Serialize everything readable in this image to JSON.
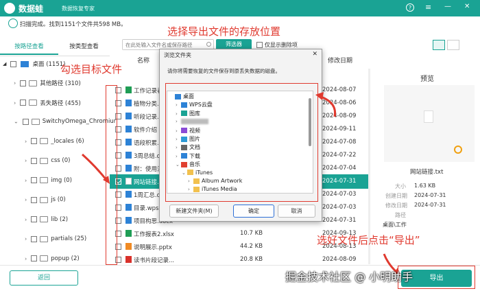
{
  "app": {
    "logo_text": "数据蛙",
    "subtitle": "数据恢复专家"
  },
  "window_controls": {
    "help": "?",
    "menu": "≡",
    "minimize": "—",
    "close": "✕"
  },
  "scan_status": "扫描完成。找到1151个文件共598 MB。",
  "tabs": {
    "by_path": "按路径查看",
    "by_type": "按类型查看"
  },
  "toolbar": {
    "search_placeholder": "在此处输入文件名或保存路径",
    "filter_button": "筛选器",
    "show_deleted_only": "仅显示删除项"
  },
  "left_tree": {
    "root_label": "桌面 (1151)",
    "items": [
      {
        "label": "其他路径 (310)",
        "indent": 1
      },
      {
        "label": "丢失路径 (455)",
        "indent": 1
      },
      {
        "label": "SwitchyOmega_Chromiur",
        "indent": 1
      },
      {
        "label": "_locales (6)",
        "indent": 2
      },
      {
        "label": "css (0)",
        "indent": 2
      },
      {
        "label": "img (0)",
        "indent": 2
      },
      {
        "label": "js (0)",
        "indent": 2
      },
      {
        "label": "lib (2)",
        "indent": 2
      },
      {
        "label": "partials (25)",
        "indent": 2
      },
      {
        "label": "popup (2)",
        "indent": 2
      }
    ]
  },
  "file_list": {
    "header": {
      "name": "名称",
      "date": "修改日期"
    },
    "rows": [
      {
        "name": "工作记录表",
        "size": "",
        "date": "2024-08-07",
        "checked": false,
        "selected": false,
        "icon": "green"
      },
      {
        "name": "植物分类.d",
        "size": "",
        "date": "2024-08-06",
        "checked": false,
        "selected": false,
        "icon": "blue"
      },
      {
        "name": "听段记录.d",
        "size": "",
        "date": "2024-08-09",
        "checked": false,
        "selected": false,
        "icon": "blue"
      },
      {
        "name": "软件介绍 -",
        "size": "",
        "date": "2024-09-11",
        "checked": false,
        "selected": false,
        "icon": "blue"
      },
      {
        "name": "语段积累.d",
        "size": "",
        "date": "2024-07-08",
        "checked": false,
        "selected": false,
        "icon": "blue"
      },
      {
        "name": "3周总结.de",
        "size": "",
        "date": "2024-07-22",
        "checked": false,
        "selected": false,
        "icon": "blue"
      },
      {
        "name": "附：使用注",
        "size": "",
        "date": "2024-07-04",
        "checked": false,
        "selected": false,
        "icon": "blue"
      },
      {
        "name": "网站链接.t",
        "size": "",
        "date": "2024-07-31",
        "checked": true,
        "selected": true,
        "icon": "white"
      },
      {
        "name": "1周汇总.do",
        "size": "",
        "date": "2024-07-03",
        "checked": false,
        "selected": false,
        "icon": "blue"
      },
      {
        "name": "目录.wps",
        "size": "",
        "date": "2024-07-03",
        "checked": false,
        "selected": false,
        "icon": "blue"
      },
      {
        "name": "项目构思.docx",
        "size": "",
        "date": "2024-07-31",
        "checked": false,
        "selected": false,
        "icon": "blue"
      },
      {
        "name": "工作报表2.xlsx",
        "size": "10.7 KB",
        "date": "2024-09-13",
        "checked": false,
        "selected": false,
        "icon": "green"
      },
      {
        "name": "说明展示.pptx",
        "size": "44.2 KB",
        "date": "2024-08-13",
        "checked": false,
        "selected": false,
        "icon": "orange"
      },
      {
        "name": "读书片段记录...",
        "size": "20.8 KB",
        "date": "2024-08-09",
        "checked": false,
        "selected": false,
        "icon": "red"
      }
    ]
  },
  "preview": {
    "title": "预览",
    "filename": "网站链接.txt",
    "size_label": "大小",
    "size_value": "1.63 KB",
    "created_label": "创建日期",
    "created_value": "2024-07-31",
    "modified_label": "修改日期",
    "modified_value": "2024-07-31",
    "path_label": "路径",
    "path_value": "桌面\\工作"
  },
  "dialog": {
    "title": "浏览文件夹",
    "instruction": "请你将需要恢复的文件保存到原丢失数据的磁盘。",
    "tree": [
      {
        "label": "桌面",
        "level": 0,
        "icon": "desktop"
      },
      {
        "label": "WPS云盘",
        "level": 1,
        "icon": "cloud"
      },
      {
        "label": "图库",
        "level": 1,
        "icon": "gallery"
      },
      {
        "label": "",
        "level": 1,
        "icon": "blurred"
      },
      {
        "label": "视频",
        "level": 1,
        "icon": "video"
      },
      {
        "label": "图片",
        "level": 1,
        "icon": "picture"
      },
      {
        "label": "文档",
        "level": 1,
        "icon": "doc"
      },
      {
        "label": "下载",
        "level": 1,
        "icon": "download"
      },
      {
        "label": "音乐",
        "level": 1,
        "icon": "music"
      },
      {
        "label": "iTunes",
        "level": 2,
        "icon": "folder"
      },
      {
        "label": "Album Artwork",
        "level": 3,
        "icon": "folder"
      },
      {
        "label": "iTunes Media",
        "level": 3,
        "icon": "folder"
      }
    ],
    "new_folder_button": "新建文件夹(M)",
    "ok_button": "确定",
    "cancel_button": "取消"
  },
  "annotations": {
    "select_location": "选择导出文件的存放位置",
    "check_target": "勾选目标文件",
    "click_export": "选好文件后点击“导出”"
  },
  "back_button": "返回",
  "export_button": "导出",
  "watermark": "掘金技术社区 @ 小明助手",
  "colors": {
    "brand": "#1aa394",
    "annotation": "#e03a2f",
    "selected_row": "#1aa394"
  }
}
